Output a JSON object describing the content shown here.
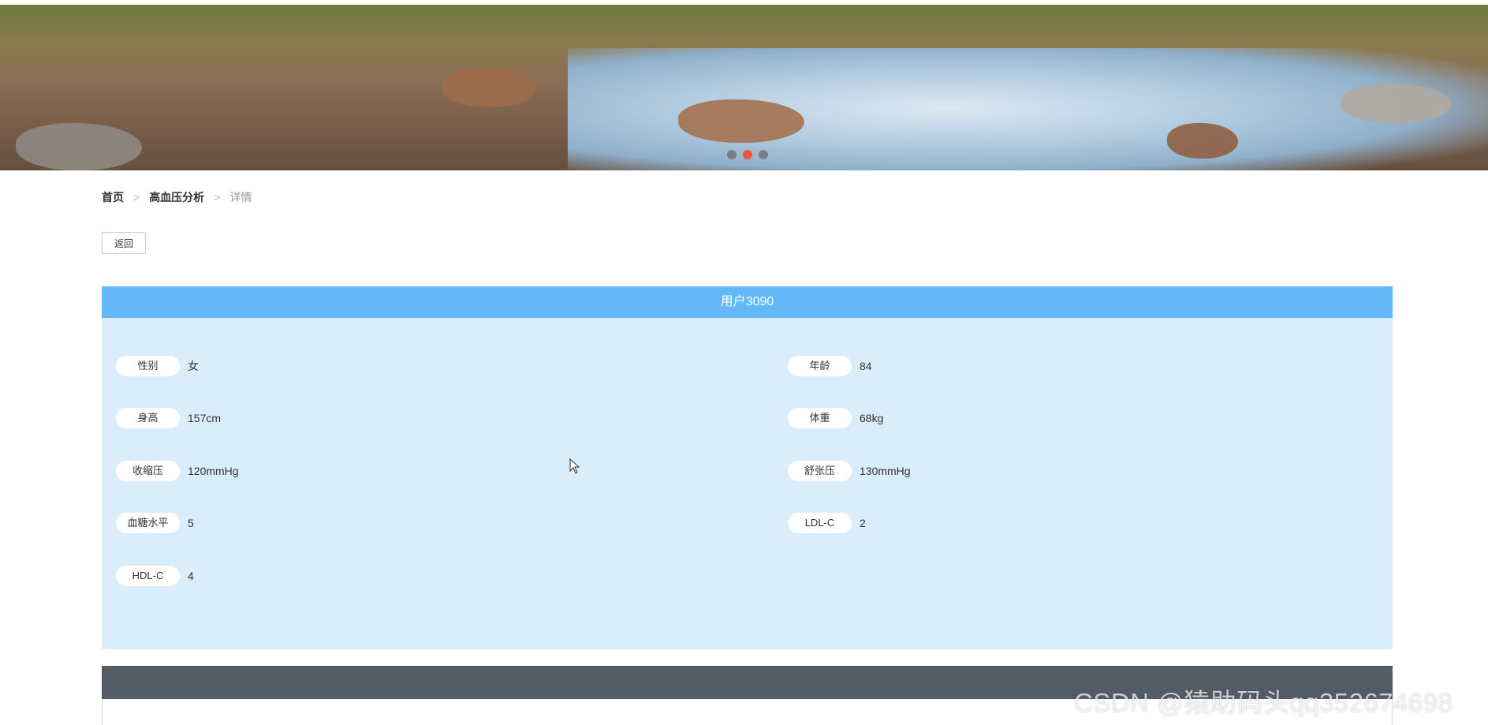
{
  "banner": {
    "slides": 3,
    "active_slide": 2
  },
  "breadcrumb": {
    "home": "首页",
    "section": "高血压分析",
    "current": "详情",
    "separator": ">"
  },
  "actions": {
    "back_label": "返回"
  },
  "detail": {
    "title": "用户3090",
    "fields": {
      "gender": {
        "label": "性别",
        "value": "女"
      },
      "age": {
        "label": "年龄",
        "value": "84"
      },
      "height": {
        "label": "身高",
        "value": "157cm"
      },
      "weight": {
        "label": "体重",
        "value": "68kg"
      },
      "systolic": {
        "label": "收缩压",
        "value": "120mmHg"
      },
      "diastolic": {
        "label": "舒张压",
        "value": "130mmHg"
      },
      "blood_sugar": {
        "label": "血糖水平",
        "value": "5"
      },
      "ldl": {
        "label": "LDL-C",
        "value": "2"
      },
      "hdl": {
        "label": "HDL-C",
        "value": "4"
      }
    }
  },
  "watermark": "CSDN @猿助码头qq352674698",
  "colors": {
    "header_blue": "#64b8f7",
    "card_bg": "#d9eefa",
    "dark_bar": "#525c65",
    "active_dot": "#e8593b"
  }
}
